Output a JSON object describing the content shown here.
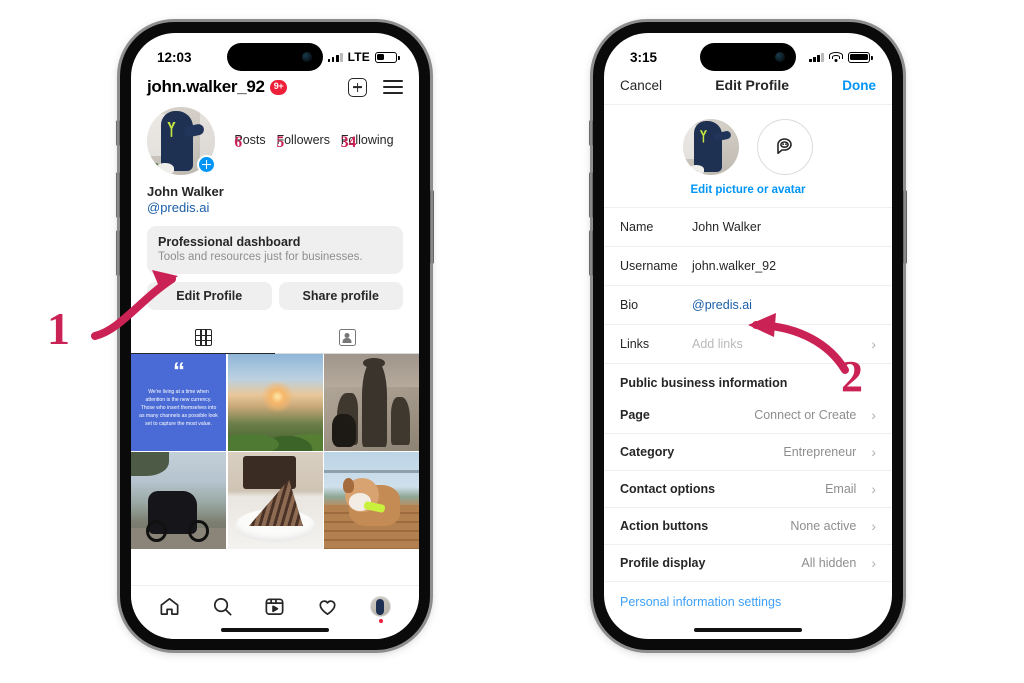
{
  "annotations": [
    {
      "number": "1",
      "points_to": "Edit Profile button"
    },
    {
      "number": "2",
      "points_to": "Links / Add links row"
    }
  ],
  "arrow_color": "#cb2255",
  "accent_blue": "#0095f6",
  "link_blue": "#1a5ea8",
  "phone_left": {
    "status_bar": {
      "time": "12:03",
      "cellular_icon": "cellular-bars-icon",
      "network": "LTE",
      "battery_icon": "battery-low-icon"
    },
    "header": {
      "username": "john.walker_92",
      "badge": "9+",
      "add_icon": "plus-box-icon",
      "menu_icon": "hamburger-menu-icon"
    },
    "profile": {
      "avatar_icon": "profile-avatar",
      "add_story_icon": "plus-circle-icon",
      "name": "John Walker",
      "bio": "@predis.ai",
      "stats": [
        {
          "number": "6",
          "label": "Posts"
        },
        {
          "number": "5",
          "label": "Followers"
        },
        {
          "number": "34",
          "label": "Following"
        }
      ]
    },
    "dashboard": {
      "title": "Professional dashboard",
      "subtitle": "Tools and resources just for businesses."
    },
    "buttons": {
      "edit_profile": "Edit Profile",
      "share_profile": "Share profile"
    },
    "tabs": [
      {
        "icon": "grid-icon",
        "active": true
      },
      {
        "icon": "tagged-person-icon",
        "active": false
      }
    ],
    "posts": [
      {
        "type": "quote",
        "quote_mark": "“",
        "text": "We're living at a time when attention is the new currency. Those who insert themselves into as many channels as possible look set to capture the most value.",
        "bg": "#4a6bd6"
      },
      {
        "type": "photo",
        "description": "sunset-beach-photo"
      },
      {
        "type": "photo",
        "description": "shadow-walk-with-dogs-photo"
      },
      {
        "type": "photo",
        "description": "motorcycle-mountain-road-photo"
      },
      {
        "type": "photo",
        "description": "chocolate-cake-slice-photo"
      },
      {
        "type": "photo",
        "description": "bulldog-on-deck-photo"
      }
    ],
    "bottom_nav": [
      {
        "icon": "home-icon"
      },
      {
        "icon": "search-icon"
      },
      {
        "icon": "reels-icon"
      },
      {
        "icon": "heart-icon"
      },
      {
        "icon": "profile-avatar-icon",
        "has_notification_dot": true
      }
    ]
  },
  "phone_right": {
    "status_bar": {
      "time": "3:15",
      "cellular_icon": "cellular-bars-icon",
      "wifi_icon": "wifi-icon",
      "battery_icon": "battery-full-icon"
    },
    "nav": {
      "cancel": "Cancel",
      "title": "Edit Profile",
      "done": "Done"
    },
    "picture_section": {
      "avatar_icon": "profile-avatar",
      "avatar_sticker_icon": "avatar-sticker-icon",
      "edit_link": "Edit picture or avatar"
    },
    "fields": [
      {
        "label": "Name",
        "value": "John Walker",
        "style": "plain",
        "chevron": false
      },
      {
        "label": "Username",
        "value": "john.walker_92",
        "style": "plain",
        "chevron": false
      },
      {
        "label": "Bio",
        "value": "@predis.ai",
        "style": "link",
        "chevron": false
      },
      {
        "label": "Links",
        "value": "Add links",
        "style": "placeholder",
        "chevron": true
      }
    ],
    "section_title": "Public business information",
    "business_rows": [
      {
        "label": "Page",
        "value": "Connect or Create",
        "chevron": true
      },
      {
        "label": "Category",
        "value": "Entrepreneur",
        "chevron": true
      },
      {
        "label": "Contact options",
        "value": "Email",
        "chevron": true
      },
      {
        "label": "Action buttons",
        "value": "None active",
        "chevron": true
      },
      {
        "label": "Profile display",
        "value": "All hidden",
        "chevron": true
      }
    ],
    "personal_settings_link": "Personal information settings"
  }
}
